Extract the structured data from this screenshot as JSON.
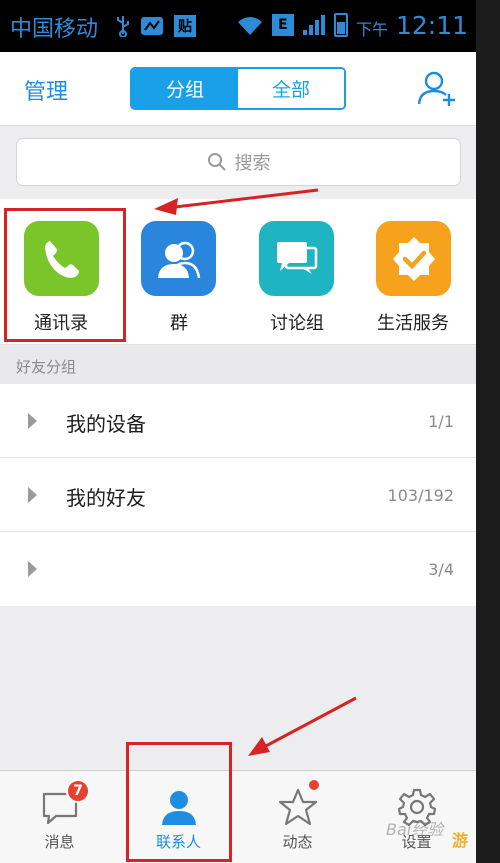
{
  "status_bar": {
    "carrier": "中国移动",
    "network_type": "E",
    "ampm": "下午",
    "time": "12:11",
    "notify_label": "贴"
  },
  "header": {
    "manage_label": "管理",
    "tabs": [
      {
        "label": "分组",
        "active": true
      },
      {
        "label": "全部",
        "active": false
      }
    ],
    "add_friend_icon": "add-contact-icon"
  },
  "search": {
    "placeholder": "搜索"
  },
  "apps": [
    {
      "label": "通讯录",
      "icon": "phone-icon",
      "color": "#7ac52a"
    },
    {
      "label": "群",
      "icon": "group-icon",
      "color": "#2a86dc"
    },
    {
      "label": "讨论组",
      "icon": "chat-bubbles-icon",
      "color": "#1fb4c2"
    },
    {
      "label": "生活服务",
      "icon": "badge-check-icon",
      "color": "#f6a21c"
    }
  ],
  "group_section": {
    "title": "好友分组",
    "items": [
      {
        "name": "我的设备",
        "count": "1/1"
      },
      {
        "name": "我的好友",
        "count": "103/192"
      },
      {
        "name": "",
        "count": "3/4"
      }
    ]
  },
  "tab_bar": {
    "items": [
      {
        "label": "消息",
        "icon": "message-icon",
        "badge": "7",
        "active": false
      },
      {
        "label": "联系人",
        "icon": "contact-icon",
        "active": true
      },
      {
        "label": "动态",
        "icon": "star-icon",
        "dot": true,
        "active": false
      },
      {
        "label": "设置",
        "icon": "gear-icon",
        "active": false
      }
    ]
  },
  "watermark": {
    "text": "Bai经验",
    "corner_text": "游"
  },
  "colors": {
    "accent": "#19a0e8",
    "annotation_red": "#d42424",
    "badge_red": "#e8412f"
  }
}
